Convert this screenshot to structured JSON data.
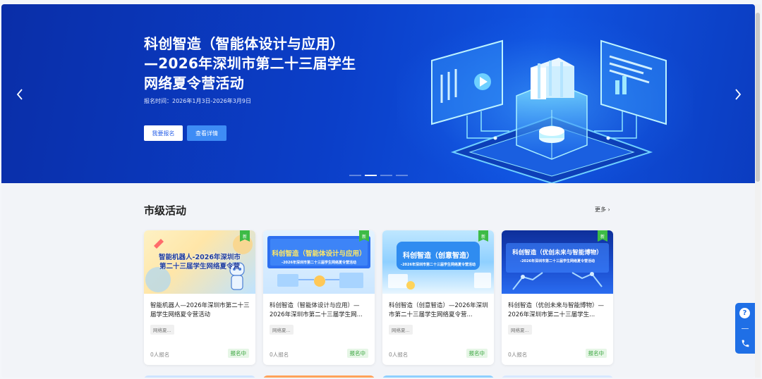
{
  "banner": {
    "title_line1": "科创智造（智能体设计与应用）",
    "title_line2": "—2026年深圳市第二十三届学生",
    "title_line3": "网络夏令营活动",
    "date": "报名时间：2026年1月3日-2026年3月9日",
    "signup_label": "我要报名",
    "detail_label": "查看详情",
    "prev_icon": "chevron-left-icon",
    "next_icon": "chevron-right-icon",
    "slide_count": 4,
    "active_slide": 2
  },
  "section": {
    "title": "市级活动",
    "more_label": "更多"
  },
  "cards": [
    {
      "title": "智能机器人—2026年深圳市第二十三届学生网络夏令营活动",
      "thumb_text1": "智能机器人-2026年深圳市",
      "thumb_text2": "第二十三届学生网络夏令营",
      "tag": "网络夏...",
      "count": "0人报名",
      "status": "报名中",
      "new_badge": "新"
    },
    {
      "title": "科创智造（智能体设计与应用）—2026年深圳市第二十三届学生网...",
      "thumb_text1": "科创智造（智能体设计与应用）",
      "thumb_text2": "-2026年深圳市第二十三届学生网络夏令营活动",
      "tag": "网络夏...",
      "count": "0人报名",
      "status": "报名中",
      "new_badge": "新"
    },
    {
      "title": "科创智造（创意智造）—2026年深圳市第二十三届学生网络夏令营...",
      "thumb_text1": "科创智造（创意智造）",
      "thumb_text2": "-2026年深圳市第二十三届学生网络夏令营活动",
      "tag": "网络夏...",
      "count": "0人报名",
      "status": "报名中",
      "new_badge": "新"
    },
    {
      "title": "科创智造（优创未来与智能博物）—2026年深圳市第二十三届学生...",
      "thumb_text1": "科创智造（优创未来与智能博物）",
      "thumb_text2": "-2026年深圳市第二十三届学生网络夏令营活动",
      "tag": "网络夏...",
      "count": "0人报名",
      "status": "报名中",
      "new_badge": "新"
    }
  ],
  "float_bar": {
    "help_icon": "question-icon",
    "phone_icon": "phone-icon"
  }
}
